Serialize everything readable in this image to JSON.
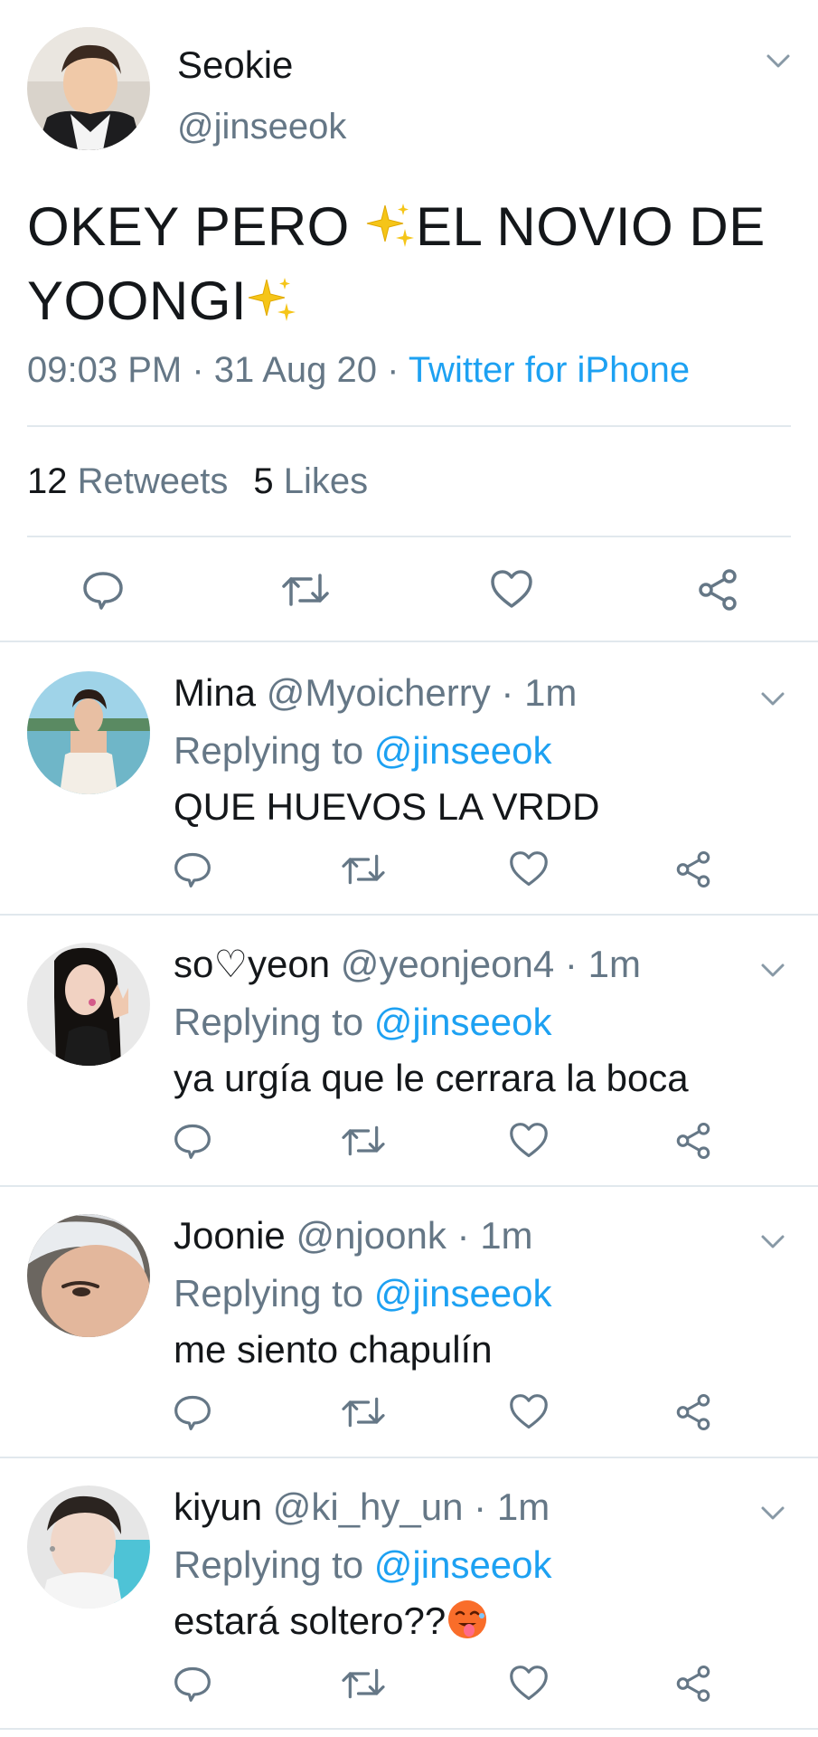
{
  "colors": {
    "text": "#14171a",
    "muted": "#657786",
    "link": "#1da1f2",
    "divider": "#e1e8ed",
    "icon": "#657786",
    "sparkles": "#f5c518"
  },
  "main_tweet": {
    "author_name": "Seokie",
    "author_handle": "@jinseeok",
    "text_part1": "OKEY PERO ",
    "text_part2": "EL NOVIO DE YOONGI",
    "time": "09:03 PM",
    "date": "31 Aug 20",
    "source": "Twitter for iPhone",
    "separator": "·",
    "retweets_count": "12",
    "retweets_label": "Retweets",
    "likes_count": "5",
    "likes_label": "Likes",
    "icons": [
      "reply-icon",
      "retweet-icon",
      "like-icon",
      "share-icon"
    ]
  },
  "replies": [
    {
      "name": "Mina",
      "handle": "@Myoicherry",
      "time": "1m",
      "replying_label": "Replying to",
      "replying_to": "@jinseeok",
      "text": "QUE HUEVOS LA VRDD"
    },
    {
      "name": "so♡yeon",
      "handle": "@yeonjeon4",
      "time": "1m",
      "replying_label": "Replying to",
      "replying_to": "@jinseeok",
      "text": "ya urgía que le cerrara la boca"
    },
    {
      "name": "Joonie",
      "handle": "@njoonk",
      "time": "1m",
      "replying_label": "Replying to",
      "replying_to": "@jinseeok",
      "text": "me siento chapulín"
    },
    {
      "name": "kiyun",
      "handle": "@ki_hy_un",
      "time": "1m",
      "replying_label": "Replying to",
      "replying_to": "@jinseeok",
      "text": "estará soltero??"
    }
  ]
}
